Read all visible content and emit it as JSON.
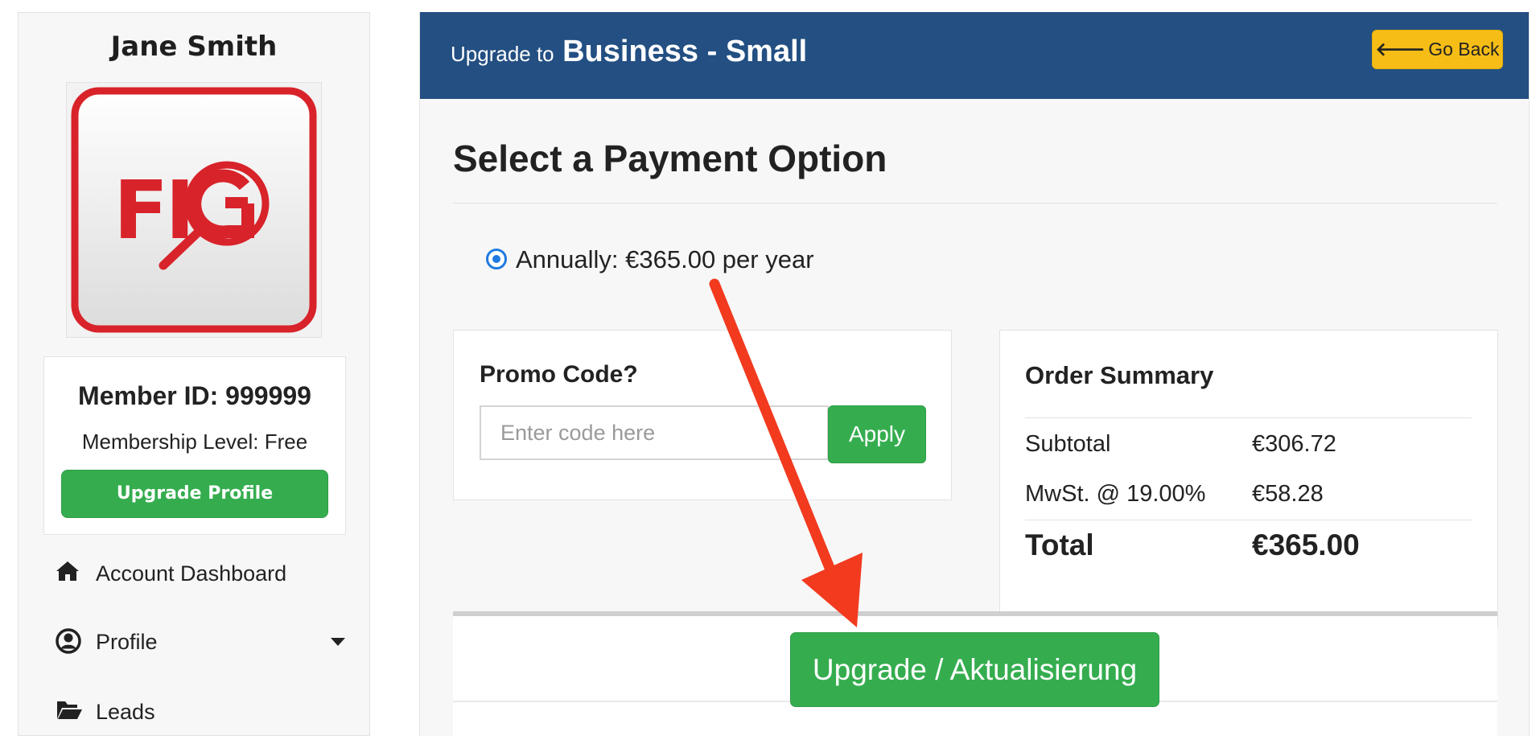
{
  "sidebar": {
    "user_name": "Jane Smith",
    "logo_text": "FIG",
    "member_id": "Member ID: 999999",
    "membership_level": "Membership Level: Free",
    "upgrade_profile_label": "Upgrade Profile",
    "nav": [
      {
        "label": "Account Dashboard",
        "icon": "home-icon"
      },
      {
        "label": "Profile",
        "icon": "user-circle-icon",
        "has_dropdown": true
      },
      {
        "label": "Leads",
        "icon": "folder-open-icon"
      }
    ]
  },
  "header": {
    "prefix": "Upgrade to",
    "plan": "Business - Small",
    "go_back_label": "Go Back",
    "go_back_icon": "arrow-left-icon"
  },
  "payment": {
    "title": "Select a Payment Option",
    "option_label": "Annually: €365.00 per year",
    "option_selected": true
  },
  "promo": {
    "title": "Promo Code?",
    "placeholder": "Enter code here",
    "value": "",
    "apply_label": "Apply"
  },
  "summary": {
    "title": "Order Summary",
    "rows": [
      {
        "label": "Subtotal",
        "value": "€306.72"
      },
      {
        "label": "MwSt. @ 19.00%",
        "value": "€58.28"
      }
    ],
    "total_label": "Total",
    "total_value": "€365.00"
  },
  "submit": {
    "label": "Upgrade / Aktualisierung"
  },
  "colors": {
    "header_bg": "#234f82",
    "primary_green": "#35ad4f",
    "warning_yellow": "#f6bd16",
    "logo_red": "#d8232a",
    "annotation_arrow": "#f23a1f"
  }
}
